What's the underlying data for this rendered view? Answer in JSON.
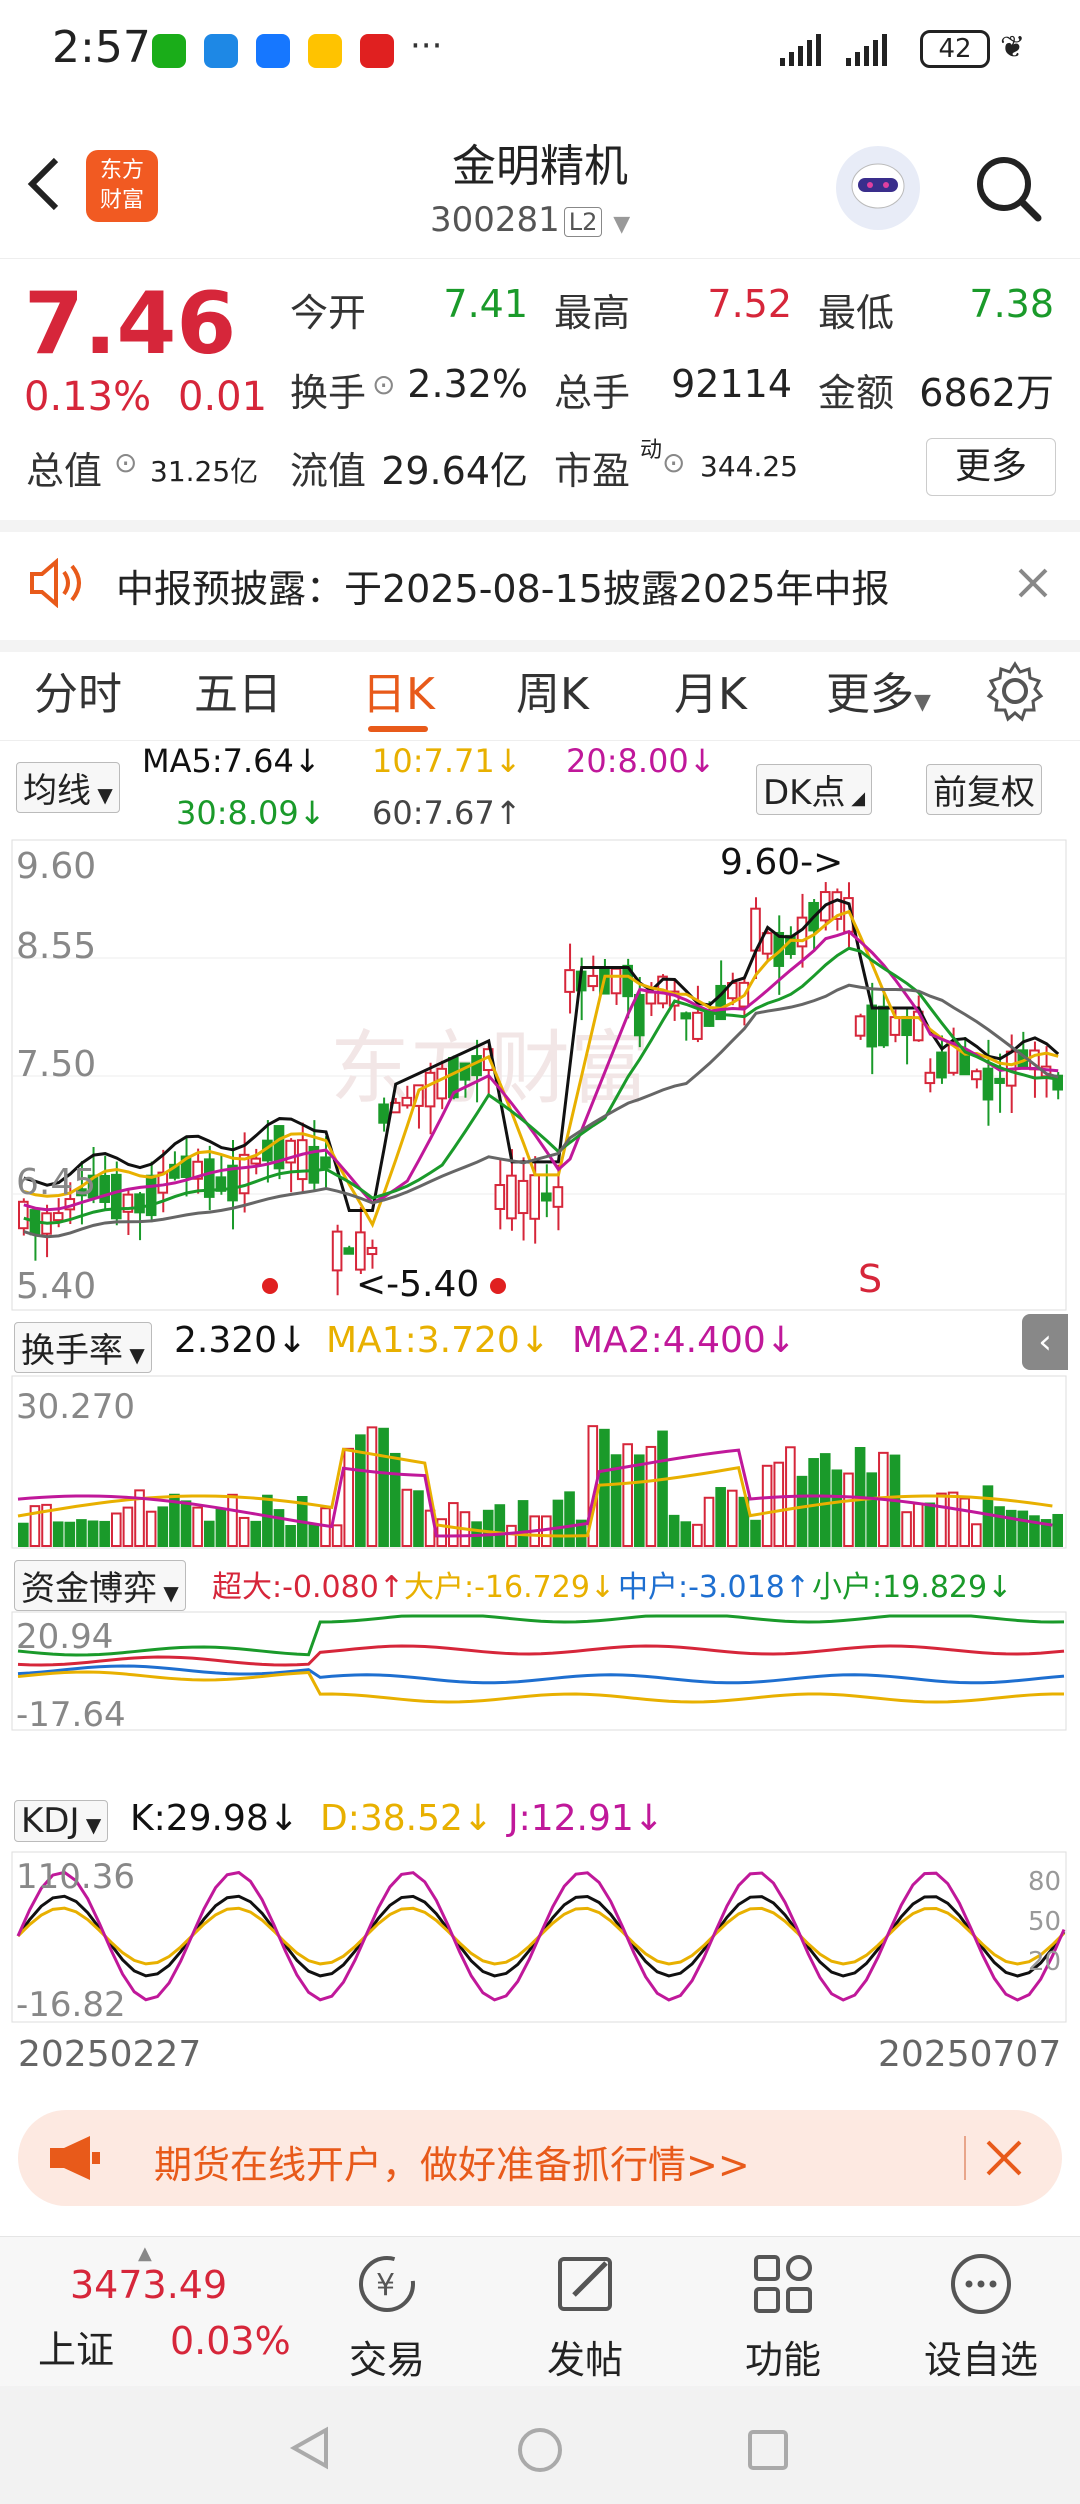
{
  "status": {
    "time": "2:57",
    "battery": "42"
  },
  "header": {
    "title": "金明精机",
    "code": "300281",
    "level": "L2",
    "logo_line1": "东方",
    "logo_line2": "财富"
  },
  "quote": {
    "price": "7.46",
    "change_pct": "0.13%",
    "change": "0.01",
    "open_label": "今开",
    "open": "7.41",
    "high_label": "最高",
    "high": "7.52",
    "low_label": "最低",
    "low": "7.38",
    "turnover_label": "换手",
    "turnover": "2.32%",
    "vol_label": "总手",
    "vol": "92114",
    "amount_label": "金额",
    "amount": "6862万",
    "mktcap_label": "总值",
    "mktcap": "31.25亿",
    "float_label": "流值",
    "float": "29.64亿",
    "pe_label": "市盈",
    "pe_sup": "动",
    "pe": "344.25",
    "more": "更多"
  },
  "notice": {
    "text": "中报预披露：于2025-08-15披露2025年中报"
  },
  "tabs": [
    "分时",
    "五日",
    "日K",
    "周K",
    "月K",
    "更多"
  ],
  "ma_panel": {
    "select": "均线",
    "ma5": "MA5:7.64↓",
    "ma10": "10:7.71↓",
    "ma20": "20:8.00↓",
    "ma30": "30:8.09↓",
    "ma60": "60:7.67↑",
    "dk": "DK点",
    "fq": "前复权"
  },
  "kline": {
    "y_labels": [
      "9.60",
      "8.55",
      "7.50",
      "6.45",
      "5.40"
    ],
    "max_note": "9.60->",
    "min_note": "<-5.40",
    "s_mark": "S",
    "watermark": "东方财富"
  },
  "vol_panel": {
    "select": "换手率",
    "value": "2.320↓",
    "ma1": "MA1:3.720↓",
    "ma2": "MA2:4.400↓",
    "top": "30.270"
  },
  "fund_panel": {
    "select": "资金博弈",
    "super": "超大:-0.080↑",
    "big": "大户:-16.729↓",
    "mid": "中户:-3.018↑",
    "small": "小户:19.829↓",
    "top": "20.94",
    "bottom": "-17.64"
  },
  "kdj_panel": {
    "select": "KDJ",
    "k": "K:29.98↓",
    "d": "D:38.52↓",
    "j": "J:12.91↓",
    "top": "110.36",
    "bottom": "-16.82",
    "r80": "80",
    "r50": "50",
    "r20": "20"
  },
  "dates": {
    "start": "20250227",
    "end": "20250707"
  },
  "ad": {
    "text": "期货在线开户，做好准备抓行情>>"
  },
  "bottom": {
    "index_value": "3473.49",
    "index_name": "上证",
    "index_pct": "0.03%",
    "items": [
      "交易",
      "发帖",
      "功能",
      "设自选"
    ]
  },
  "colors": {
    "up": "#d6263a",
    "down": "#1a9a2a",
    "accent": "#e85a1a",
    "ma5": "#111111",
    "ma10": "#e8b000",
    "ma20": "#c0189a",
    "ma30": "#1a9a2a",
    "ma60": "#666666"
  }
}
